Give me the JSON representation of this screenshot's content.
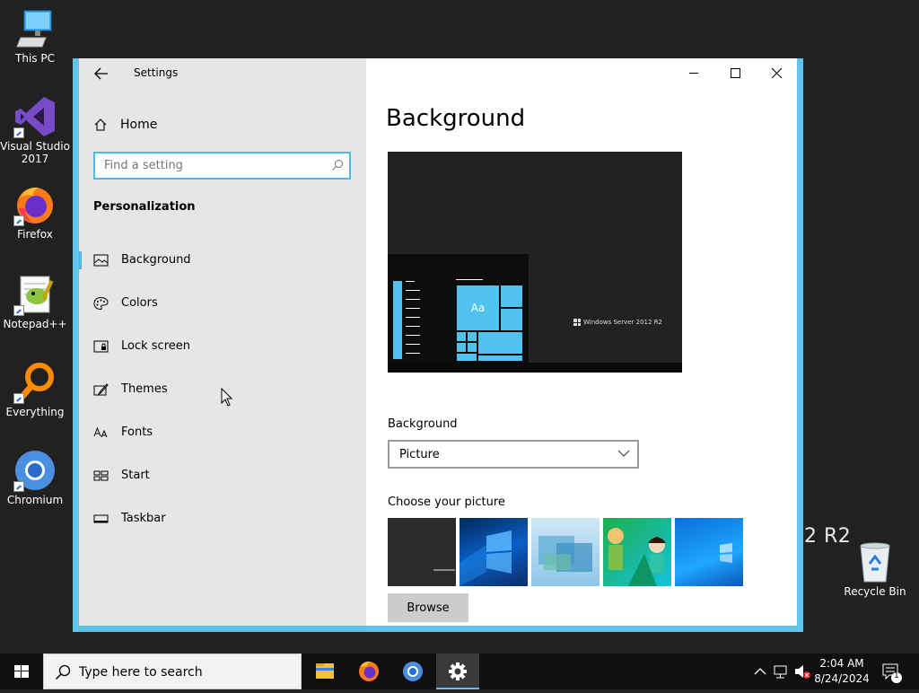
{
  "desktop": {
    "icons": [
      {
        "label": "This PC"
      },
      {
        "label": "Visual Studio 2017"
      },
      {
        "label": "Firefox"
      },
      {
        "label": "Notepad++"
      },
      {
        "label": "Everything"
      },
      {
        "label": "Chromium"
      },
      {
        "label": "Recycle Bin"
      }
    ],
    "watermark": "2 R2"
  },
  "window": {
    "app_title": "Settings",
    "title_buttons": [
      "minimize-icon",
      "maximize-icon",
      "close-icon"
    ]
  },
  "sidebar": {
    "home_label": "Home",
    "search_placeholder": "Find a setting",
    "section_title": "Personalization",
    "items": [
      {
        "label": "Background",
        "icon": "picture-icon",
        "active": true
      },
      {
        "label": "Colors",
        "icon": "palette-icon",
        "active": false
      },
      {
        "label": "Lock screen",
        "icon": "lock-screen-icon",
        "active": false
      },
      {
        "label": "Themes",
        "icon": "brush-icon",
        "active": false
      },
      {
        "label": "Fonts",
        "icon": "font-icon",
        "active": false
      },
      {
        "label": "Start",
        "icon": "start-icon",
        "active": false
      },
      {
        "label": "Taskbar",
        "icon": "taskbar-icon",
        "active": false
      }
    ]
  },
  "main": {
    "page_title": "Background",
    "preview": {
      "tile_label": "Aa",
      "logo_text": "Windows Server 2012 R2"
    },
    "background_label": "Background",
    "background_value": "Picture",
    "choose_picture_label": "Choose your picture",
    "thumbnails": [
      "dark-wallpaper",
      "windows-10-hero",
      "light-blue-abstract",
      "cartoon-characters",
      "windows-10-blue"
    ],
    "browse_label": "Browse"
  },
  "taskbar": {
    "search_placeholder": "Type here to search",
    "apps": [
      "file-explorer-icon",
      "firefox-icon",
      "chromium-icon",
      "settings-gear-icon"
    ],
    "clock_time": "2:04 AM",
    "clock_date": "8/24/2024",
    "notification_count": "1"
  }
}
